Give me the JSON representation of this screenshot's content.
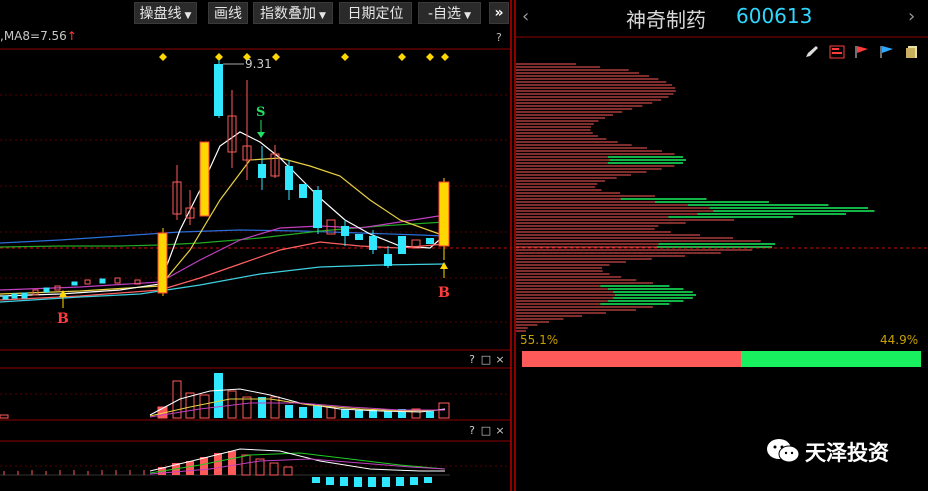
{
  "toolbar": {
    "buttons": [
      {
        "label": "操盘线",
        "has_dropdown": true
      },
      {
        "label": "画线",
        "has_dropdown": false
      },
      {
        "label": "指数叠加",
        "has_dropdown": true
      },
      {
        "label": "日期定位",
        "has_dropdown": false
      },
      {
        "label": "-自选",
        "has_dropdown": true
      }
    ],
    "arrow_glyph": "▼",
    "collapse_glyph": "»"
  },
  "indicator_line": {
    "text": ",MA8=7.56",
    "arrow": "↑"
  },
  "price_chart": {
    "peak_label": "9.31",
    "sell_marker": "S",
    "buy_marker": "B",
    "buy_marker_2": "B"
  },
  "pane_controls": {
    "help": "?",
    "maximize": "□",
    "close": "×"
  },
  "stock": {
    "name": "神奇制药",
    "code": "600613",
    "prev": "‹",
    "next": "›"
  },
  "chip": {
    "left_pct": "55.1%",
    "right_pct": "44.9%",
    "red_share": 0.551
  },
  "right_icons": [
    "pencil-icon",
    "chip-red-icon",
    "flag-red-icon",
    "flag-blue-icon",
    "doc-icon"
  ],
  "watermark": {
    "text": "天泽投资"
  },
  "colors": {
    "up": "#ff5a5a",
    "down": "#2fe8ff",
    "chip_green": "#18f060",
    "frame": "#8b0000"
  }
}
